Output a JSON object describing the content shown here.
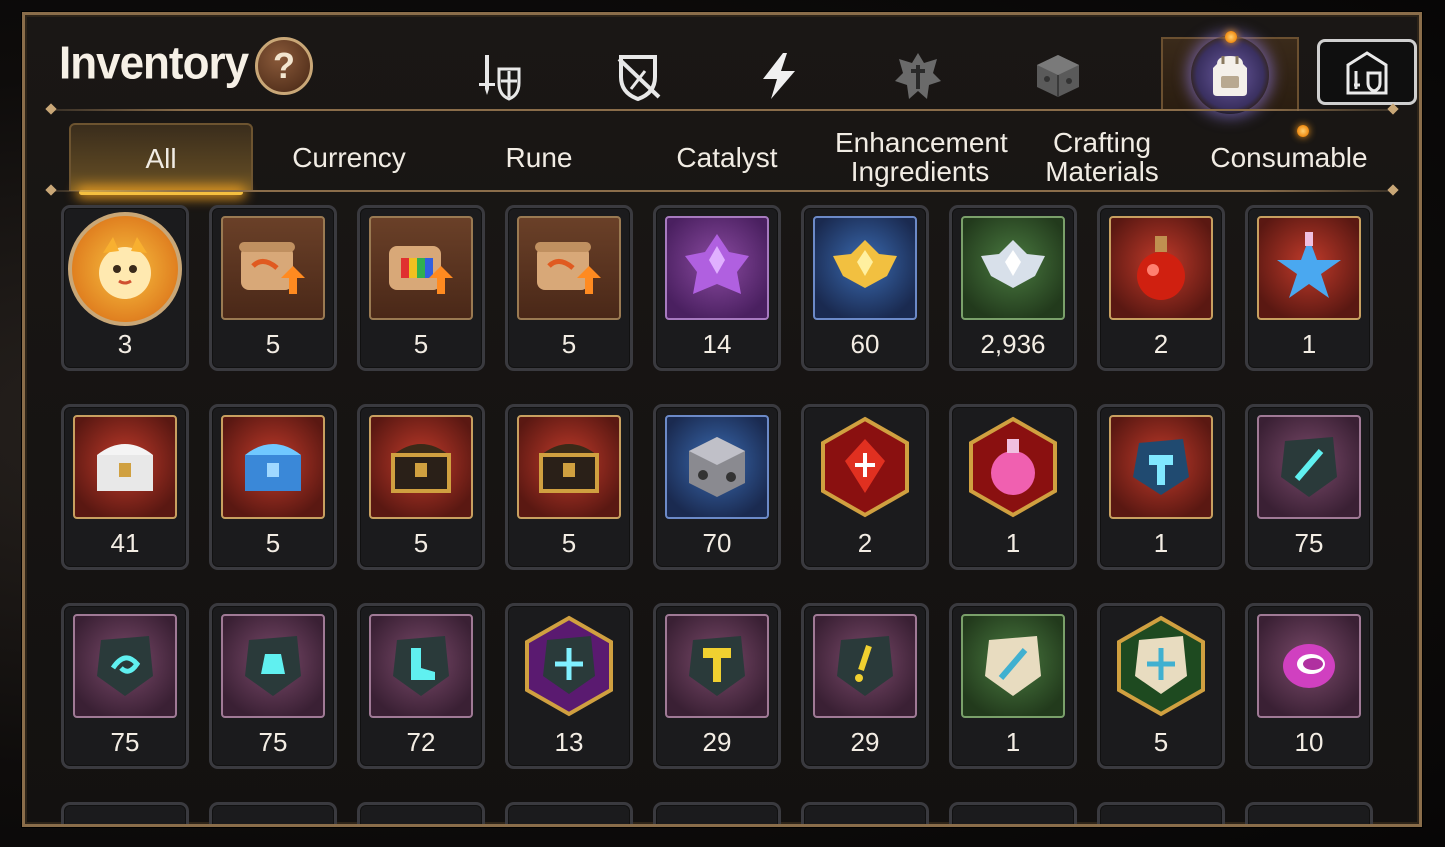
{
  "header": {
    "title": "Inventory",
    "help_label": "?"
  },
  "top_icons": [
    {
      "name": "knight-shield-icon",
      "active": false
    },
    {
      "name": "broken-shield-icon",
      "active": false
    },
    {
      "name": "lightning-icon",
      "active": false
    },
    {
      "name": "crest-icon",
      "active": false
    },
    {
      "name": "cube-icon",
      "active": false
    },
    {
      "name": "backpack-icon",
      "active": true
    },
    {
      "name": "castle-icon",
      "active": false
    }
  ],
  "tabs": [
    {
      "label": "All",
      "active": true
    },
    {
      "label": "Currency",
      "active": false
    },
    {
      "label": "Rune",
      "active": false
    },
    {
      "label": "Catalyst",
      "active": false
    },
    {
      "label": "Enhancement Ingredients",
      "active": false
    },
    {
      "label": "Crafting Materials",
      "active": false
    },
    {
      "label": "Consumable",
      "active": false,
      "notification": true
    }
  ],
  "items": [
    {
      "icon": "pet-token-icon",
      "qty": "3",
      "frame": "round"
    },
    {
      "icon": "scroll-upgrade-icon",
      "qty": "5",
      "frame": "b-brown"
    },
    {
      "icon": "rainbow-scroll-icon",
      "qty": "5",
      "frame": "b-brown"
    },
    {
      "icon": "scroll-upgrade-icon",
      "qty": "5",
      "frame": "b-brown"
    },
    {
      "icon": "purple-crystal-icon",
      "qty": "14",
      "frame": "b-purple"
    },
    {
      "icon": "gold-crystal-icon",
      "qty": "60",
      "frame": "b-blue"
    },
    {
      "icon": "silver-crystal-icon",
      "qty": "2,936",
      "frame": "b-green"
    },
    {
      "icon": "red-potion-icon",
      "qty": "2",
      "frame": "b-red"
    },
    {
      "icon": "star-potion-icon",
      "qty": "1",
      "frame": "b-red"
    },
    {
      "icon": "silver-chest-icon",
      "qty": "41",
      "frame": "b-red"
    },
    {
      "icon": "blue-chest-icon",
      "qty": "5",
      "frame": "b-red"
    },
    {
      "icon": "gold-chest-icon",
      "qty": "5",
      "frame": "b-red"
    },
    {
      "icon": "gold-chest-icon",
      "qty": "5",
      "frame": "b-red"
    },
    {
      "icon": "dark-cube-icon",
      "qty": "70",
      "frame": "b-blue"
    },
    {
      "icon": "red-gem-icon",
      "qty": "2",
      "frame": "hex-red"
    },
    {
      "icon": "pink-potion-icon",
      "qty": "1",
      "frame": "hex-red"
    },
    {
      "icon": "hammer-stone-icon",
      "qty": "1",
      "frame": "b-red"
    },
    {
      "icon": "sword-rune-icon",
      "qty": "75",
      "frame": "b-mauve"
    },
    {
      "icon": "spiral-rune-icon",
      "qty": "75",
      "frame": "b-mauve"
    },
    {
      "icon": "bell-rune-icon",
      "qty": "75",
      "frame": "b-mauve"
    },
    {
      "icon": "boot-rune-icon",
      "qty": "72",
      "frame": "b-mauve"
    },
    {
      "icon": "cross-rune-icon",
      "qty": "13",
      "frame": "hex-purple"
    },
    {
      "icon": "hammer-rune-icon",
      "qty": "29",
      "frame": "b-mauve"
    },
    {
      "icon": "exclaim-rune-icon",
      "qty": "29",
      "frame": "b-mauve"
    },
    {
      "icon": "sword-stone-icon",
      "qty": "1",
      "frame": "b-green"
    },
    {
      "icon": "cross-stone-icon",
      "qty": "5",
      "frame": "hex-green"
    },
    {
      "icon": "pink-orb-icon",
      "qty": "10",
      "frame": "b-mauve"
    }
  ],
  "colors": {
    "frame_gold": "#c9a777",
    "tab_highlight": "#f5c040",
    "text": "#f3ede4"
  }
}
